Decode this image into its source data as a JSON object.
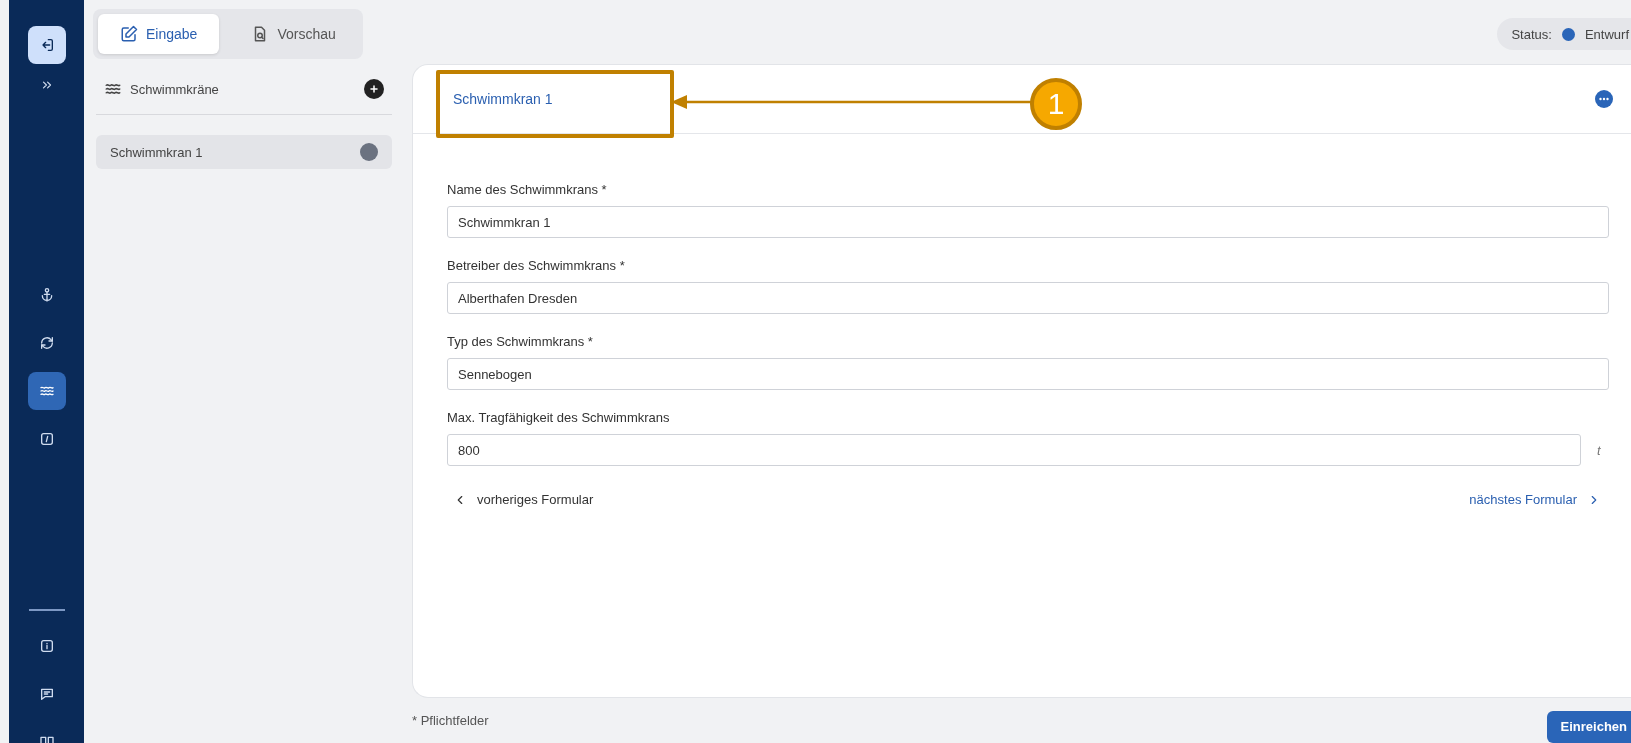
{
  "sidebar": {
    "nav_items": [
      {
        "kind": "anchor",
        "selected": false
      },
      {
        "kind": "sync",
        "selected": false
      },
      {
        "kind": "waves",
        "selected": true
      },
      {
        "kind": "edit",
        "selected": false
      }
    ],
    "bottom_items": [
      {
        "kind": "info",
        "selected": false
      },
      {
        "kind": "chat",
        "selected": false
      },
      {
        "kind": "book",
        "selected": false
      }
    ]
  },
  "tabs": [
    {
      "label": "Eingabe",
      "kind": "edit",
      "selected": true
    },
    {
      "label": "Vorschau",
      "kind": "preview",
      "selected": false
    }
  ],
  "status": {
    "label": "Status:",
    "value": "Entwurf",
    "color": "#2a65b8"
  },
  "list": {
    "title": "Schwimmkräne",
    "items": [
      {
        "label": "Schwimmkran 1",
        "selected": true,
        "color": "#6b7280"
      }
    ]
  },
  "form": {
    "title": "Schwimmkran 1",
    "fields": [
      {
        "label": "Name des Schwimmkrans *",
        "value": "Schwimmkran 1"
      },
      {
        "label": "Betreiber des Schwimmkrans *",
        "value": "Alberthafen Dresden"
      },
      {
        "label": "Typ des Schwimmkrans *",
        "value": "Sennebogen"
      },
      {
        "label": "Max. Tragfähigkeit des Schwimmkrans",
        "value": "800",
        "unit": "t"
      }
    ],
    "prev": "vorheriges Formular",
    "next": "nächstes Formular"
  },
  "footer": {
    "note": "* Pflichtfelder",
    "submit": "Einreichen"
  },
  "annotation": {
    "label": "1"
  }
}
